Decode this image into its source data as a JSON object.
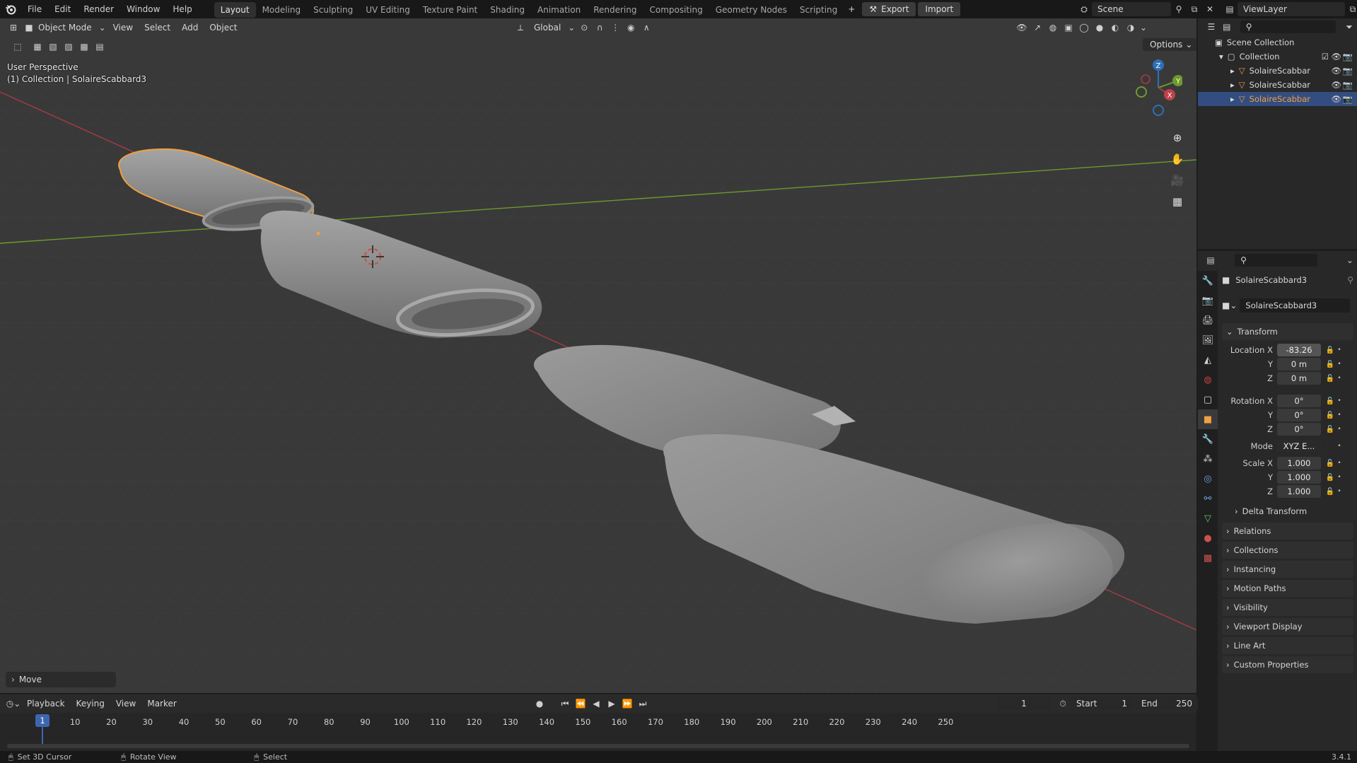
{
  "topbar": {
    "menus": [
      "File",
      "Edit",
      "Render",
      "Window",
      "Help"
    ],
    "workspaces": [
      "Layout",
      "Modeling",
      "Sculpting",
      "UV Editing",
      "Texture Paint",
      "Shading",
      "Animation",
      "Rendering",
      "Compositing",
      "Geometry Nodes",
      "Scripting"
    ],
    "active_workspace": "Layout",
    "add_workspace": "+",
    "export_label": "Export",
    "import_label": "Import",
    "scene_name": "Scene",
    "view_layer": "ViewLayer"
  },
  "viewport_header": {
    "mode": "Object Mode",
    "menus": [
      "View",
      "Select",
      "Add",
      "Object"
    ],
    "transform_orientation": "Global",
    "options_label": "Options"
  },
  "viewport": {
    "view_name": "User Perspective",
    "context": "(1) Collection | SolaireScabbard3",
    "last_operator": "Move",
    "gizmo_axes": {
      "x": "X",
      "y": "Y",
      "z": "Z"
    },
    "colors": {
      "background": "#393939",
      "x_axis": "#a83a44",
      "y_axis": "#6e9a2c",
      "selection_outline": "#f0a040"
    }
  },
  "outliner": {
    "scene_collection": "Scene Collection",
    "collection": "Collection",
    "objects": [
      {
        "name": "SolaireScabbar",
        "selected": false
      },
      {
        "name": "SolaireScabbar",
        "selected": false
      },
      {
        "name": "SolaireScabbar",
        "selected": true
      }
    ]
  },
  "properties": {
    "object_name": "SolaireScabbard3",
    "datablock_name": "SolaireScabbard3",
    "transform_title": "Transform",
    "location": {
      "label_x": "Location X",
      "label_y": "Y",
      "label_z": "Z",
      "x": "-83.26",
      "y": "0 m",
      "z": "0 m"
    },
    "rotation": {
      "label_x": "Rotation X",
      "label_y": "Y",
      "label_z": "Z",
      "x": "0°",
      "y": "0°",
      "z": "0°"
    },
    "mode": {
      "label": "Mode",
      "value": "XYZ E..."
    },
    "scale": {
      "label_x": "Scale X",
      "label_y": "Y",
      "label_z": "Z",
      "x": "1.000",
      "y": "1.000",
      "z": "1.000"
    },
    "delta_transform": "Delta Transform",
    "panels": [
      "Relations",
      "Collections",
      "Instancing",
      "Motion Paths",
      "Visibility",
      "Viewport Display",
      "Line Art",
      "Custom Properties"
    ]
  },
  "timeline": {
    "menus": [
      "Playback",
      "Keying",
      "View",
      "Marker"
    ],
    "current_frame": "1",
    "start_label": "Start",
    "start": "1",
    "end_label": "End",
    "end": "250",
    "ticks": [
      "10",
      "20",
      "30",
      "40",
      "50",
      "60",
      "70",
      "80",
      "90",
      "100",
      "110",
      "120",
      "130",
      "140",
      "150",
      "160",
      "170",
      "180",
      "190",
      "200",
      "210",
      "220",
      "230",
      "240",
      "250"
    ]
  },
  "statusbar": {
    "hint1": "Set 3D Cursor",
    "hint2": "Rotate View",
    "hint3": "Select",
    "version": "3.4.1"
  }
}
